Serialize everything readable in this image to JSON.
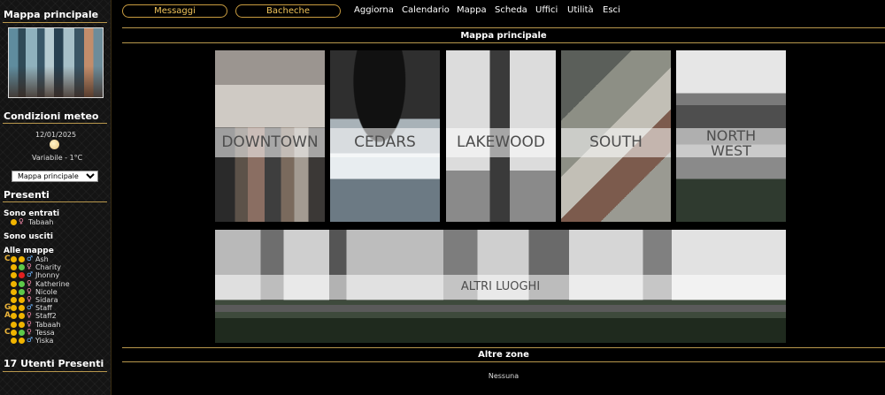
{
  "sidebar": {
    "title": "Mappa principale",
    "weather": {
      "title": "Condizioni meteo",
      "date": "12/01/2025",
      "icon": "moon-icon",
      "description": "Variabile - 1°C"
    },
    "map_select": {
      "selected": "Mappa principale"
    },
    "present": {
      "title": "Presenti",
      "entered_label": "Sono entrati",
      "entered": [
        {
          "name": "Tabaah",
          "gender": "♀"
        }
      ],
      "exited_label": "Sono usciti",
      "all_maps_label": "Alle mappe",
      "users": [
        {
          "role": "C",
          "status": "#f0b400",
          "gender": "♂",
          "name": "Ash"
        },
        {
          "role": "",
          "status": "#5ec94a",
          "gender": "♀",
          "name": "Charity"
        },
        {
          "role": "",
          "status": "#e02020",
          "gender": "♂",
          "name": "Jhonny"
        },
        {
          "role": "",
          "status": "#5ec94a",
          "gender": "♀",
          "name": "Katherine"
        },
        {
          "role": "",
          "status": "#5ec94a",
          "gender": "♀",
          "name": "Nicole"
        },
        {
          "role": "",
          "status": "#f0b400",
          "gender": "♀",
          "name": "Sidara"
        },
        {
          "role": "G",
          "status": "#f0b400",
          "gender": "♂",
          "name": "Staff"
        },
        {
          "role": "A",
          "status": "#f0b400",
          "gender": "♀",
          "name": "Staff2"
        },
        {
          "role": "",
          "status": "#f0b400",
          "gender": "♀",
          "name": "Tabaah"
        },
        {
          "role": "C",
          "status": "#5ec94a",
          "gender": "♀",
          "name": "Tessa"
        },
        {
          "role": "",
          "status": "#f0b400",
          "gender": "♂",
          "name": "Yiska"
        }
      ],
      "count_label": "17 Utenti Presenti"
    }
  },
  "nav": {
    "pill_messages": "Messaggi",
    "pill_boards": "Bacheche",
    "links": [
      "Aggiorna",
      "Calendario",
      "Mappa",
      "Scheda",
      "Uffici",
      "Utilità",
      "Esci"
    ]
  },
  "main": {
    "title": "Mappa principale",
    "tiles": [
      {
        "id": "downtown",
        "label": "DOWNTOWN"
      },
      {
        "id": "cedars",
        "label": "CEDARS"
      },
      {
        "id": "lakewood",
        "label": "LAKEWOOD"
      },
      {
        "id": "south",
        "label": "SOUTH"
      },
      {
        "id": "northwest",
        "label_line1": "NORTH",
        "label_line2": "WEST"
      }
    ],
    "altri": "ALTRI LUOGHI",
    "other_zones_title": "Altre zone",
    "other_zones_text": "Nessuna"
  },
  "colors": {
    "accent_gold": "#b8974c",
    "pill_text": "#f0c45a",
    "status_online": "#5ec94a",
    "status_away": "#f0b400",
    "status_busy": "#e02020"
  }
}
